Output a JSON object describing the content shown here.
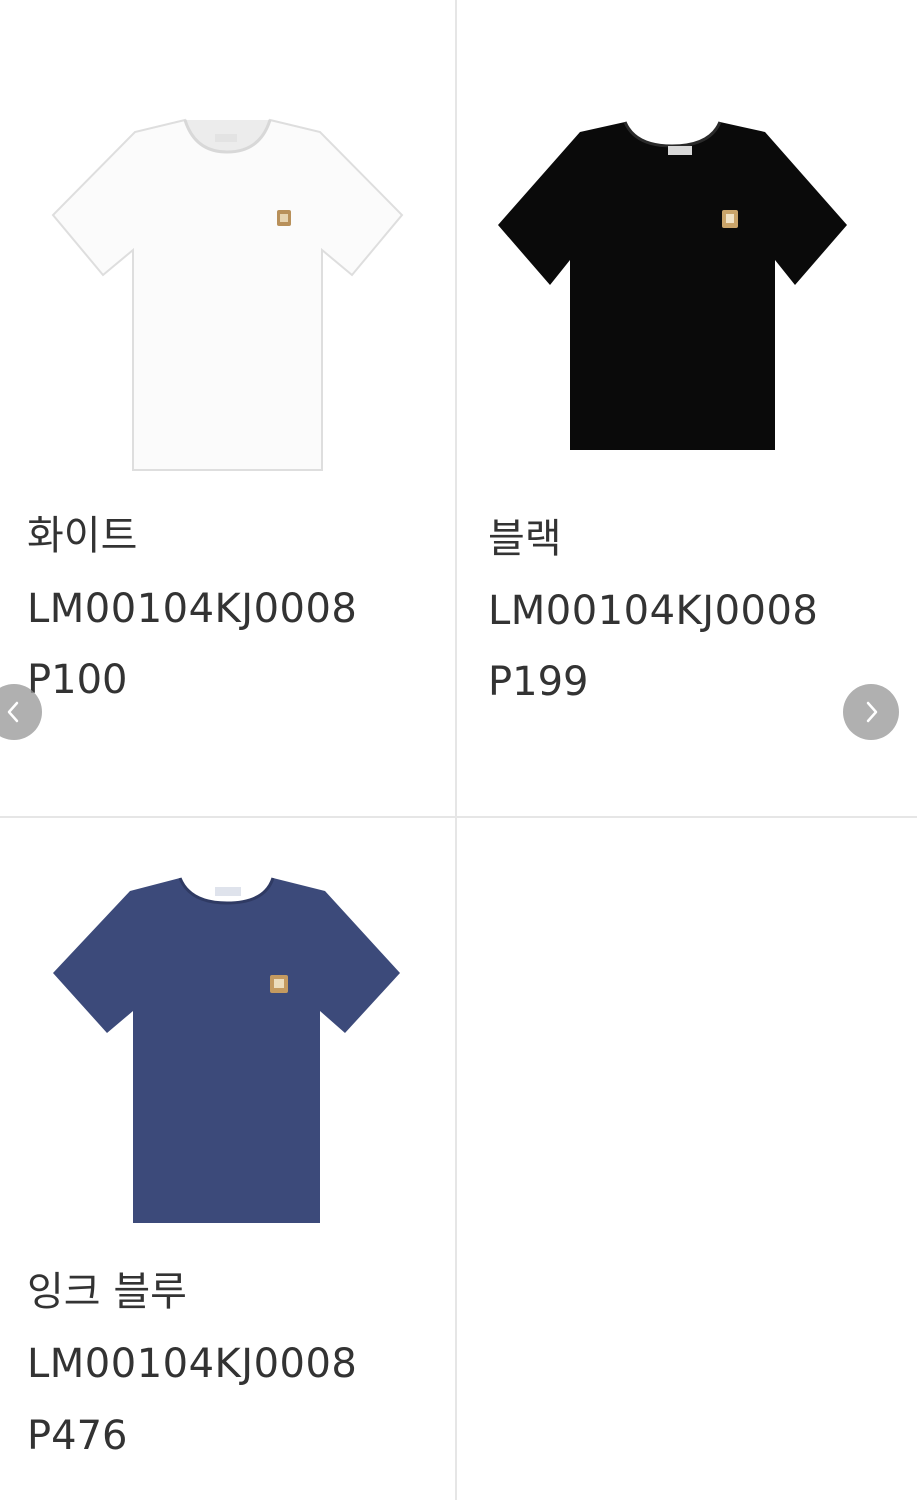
{
  "products": [
    {
      "name": "화이트",
      "code": "LM00104KJ0008",
      "price": "P100",
      "image_icon": "white-tshirt-icon",
      "color": "#f7f7f7"
    },
    {
      "name": "블랙",
      "code": "LM00104KJ0008",
      "price": "P199",
      "image_icon": "black-tshirt-icon",
      "color": "#0a0a0a"
    },
    {
      "name": "잉크 블루",
      "code": "LM00104KJ0008",
      "price": "P476",
      "image_icon": "ink-blue-tshirt-icon",
      "color": "#3c4a7a"
    }
  ],
  "navigation": {
    "prev_icon": "chevron-left-icon",
    "next_icon": "chevron-right-icon"
  }
}
